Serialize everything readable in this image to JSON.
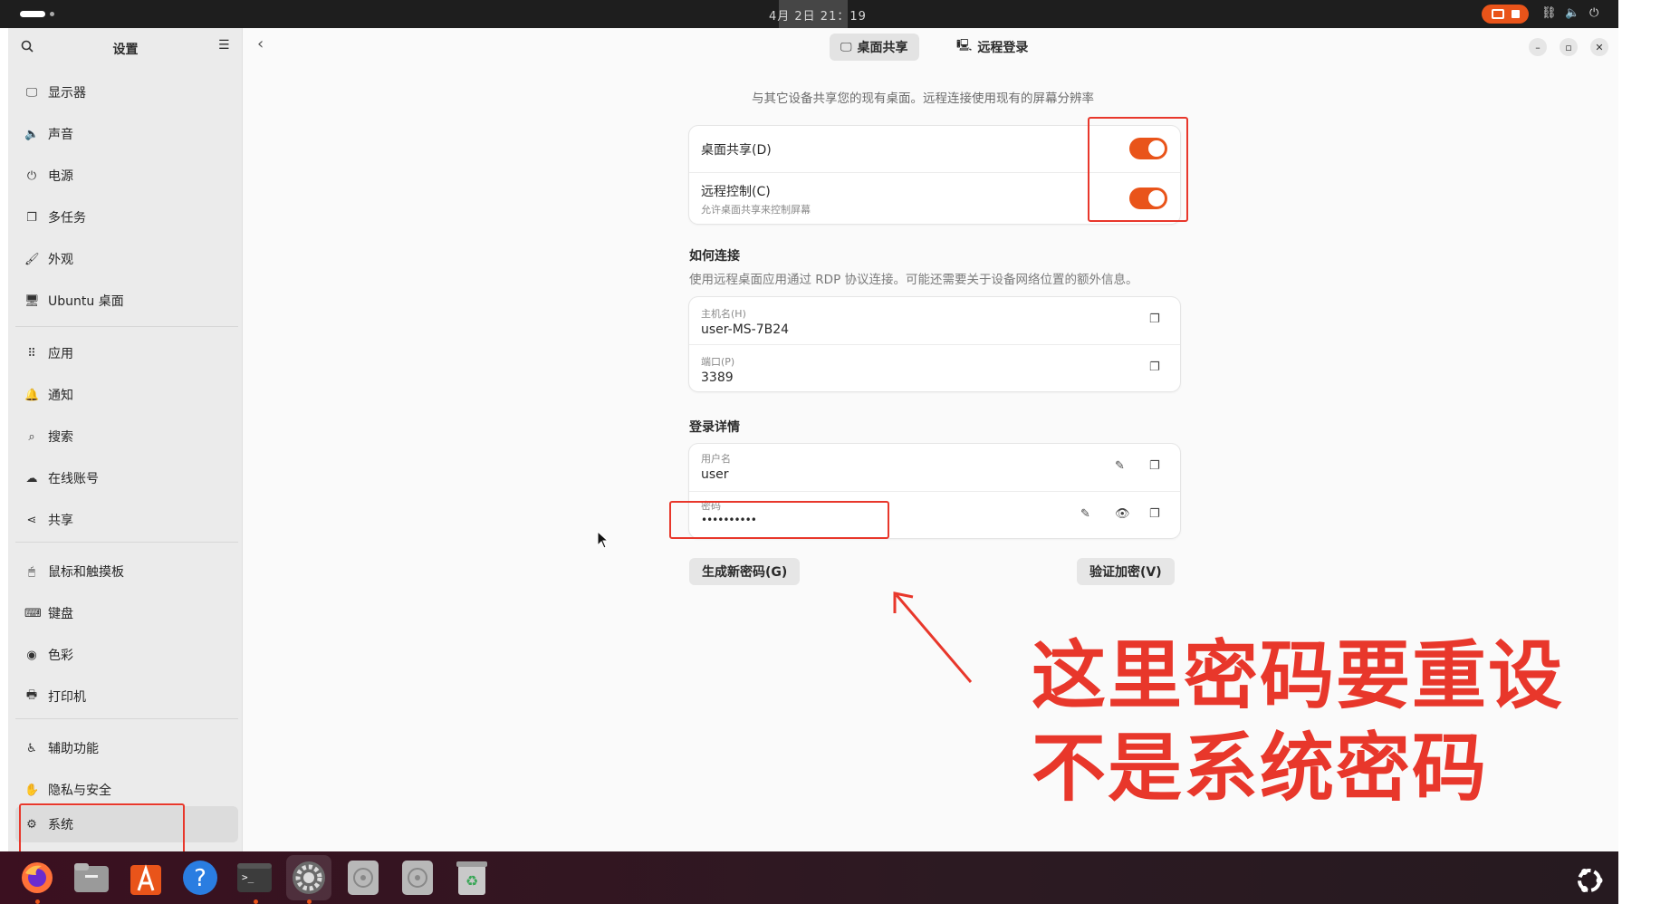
{
  "topbar": {
    "clock": "4月 2日  21：19"
  },
  "sidebar": {
    "title": "设置",
    "items": [
      {
        "label": "显示器",
        "icon": "monitor-icon",
        "glyph": "🖵"
      },
      {
        "label": "声音",
        "icon": "speaker-icon",
        "glyph": "🔈"
      },
      {
        "label": "电源",
        "icon": "power-icon",
        "glyph": "⏻"
      },
      {
        "label": "多任务",
        "icon": "multitask-icon",
        "glyph": "❐"
      },
      {
        "label": "外观",
        "icon": "appearance-icon",
        "glyph": "🖌"
      },
      {
        "label": "Ubuntu 桌面",
        "icon": "ubuntu-desktop-icon",
        "glyph": "🖥"
      },
      {
        "label": "应用",
        "icon": "apps-icon",
        "glyph": "⠿"
      },
      {
        "label": "通知",
        "icon": "bell-icon",
        "glyph": "🔔"
      },
      {
        "label": "搜索",
        "icon": "search-icon",
        "glyph": "⌕"
      },
      {
        "label": "在线账号",
        "icon": "cloud-icon",
        "glyph": "☁"
      },
      {
        "label": "共享",
        "icon": "share-icon",
        "glyph": "⋖"
      },
      {
        "label": "鼠标和触摸板",
        "icon": "mouse-icon",
        "glyph": "🖱"
      },
      {
        "label": "键盘",
        "icon": "keyboard-icon",
        "glyph": "⌨"
      },
      {
        "label": "色彩",
        "icon": "color-icon",
        "glyph": "◉"
      },
      {
        "label": "打印机",
        "icon": "printer-icon",
        "glyph": "🖶"
      },
      {
        "label": "辅助功能",
        "icon": "accessibility-icon",
        "glyph": "♿"
      },
      {
        "label": "隐私与安全",
        "icon": "hand-icon",
        "glyph": "✋"
      },
      {
        "label": "系统",
        "icon": "gear-icon",
        "glyph": "⚙"
      }
    ]
  },
  "header": {
    "tab_desktop_sharing": "桌面共享",
    "tab_remote_login": "远程登录"
  },
  "main": {
    "subtitle": "与其它设备共享您的现有桌面。远程连接使用现有的屏幕分辨率",
    "toggles": {
      "desktop_sharing": {
        "label": "桌面共享(D)",
        "on": true
      },
      "remote_control": {
        "label": "远程控制(C)",
        "sublabel": "允许桌面共享来控制屏幕",
        "on": true
      }
    },
    "how_to_connect": {
      "title": "如何连接",
      "desc": "使用远程桌面应用通过 RDP 协议连接。可能还需要关于设备网络位置的额外信息。",
      "hostname_label": "主机名(H)",
      "hostname_value": "user-MS-7B24",
      "port_label": "端口(P)",
      "port_value": "3389"
    },
    "login_details": {
      "title": "登录详情",
      "username_label": "用户名",
      "username_value": "user",
      "password_label": "密码",
      "password_value": "••••••••••"
    },
    "generate_button": "生成新密码(G)",
    "verify_button": "验证加密(V)"
  },
  "annotation": {
    "line1": "这里密码要重设",
    "line2": "不是系统密码",
    "color": "#e8372b"
  },
  "colors": {
    "accent": "#e9541a"
  }
}
